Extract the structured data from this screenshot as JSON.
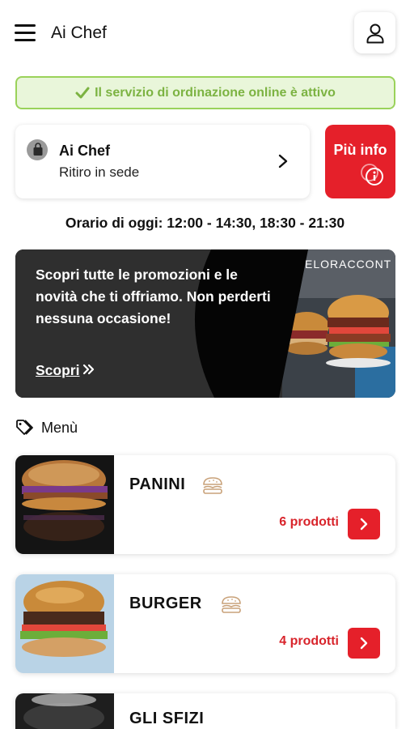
{
  "header": {
    "app_title": "Ai Chef",
    "menu_icon": "hamburger-icon",
    "user_icon": "user-icon"
  },
  "status": {
    "text": "Il servizio di ordinazione online è attivo",
    "icon": "check-icon",
    "color": "#7cb342"
  },
  "store": {
    "name": "Ai Chef",
    "mode": "Ritiro in sede",
    "icon": "shopping-bag-icon"
  },
  "info_button": {
    "label": "Più info",
    "icon": "info-icon",
    "color": "#e5202a"
  },
  "hours": {
    "text": "Orario di oggi: 12:00 - 14:30, 18:30 - 21:30"
  },
  "promo": {
    "text": "Scopri tutte le promozioni e le novità che ti offriamo. Non perderti nessuna occasione!",
    "link_label": "Scopri",
    "image_caption": "ELORACCONT"
  },
  "menu": {
    "heading": "Menù",
    "heading_icon": "tag-icon",
    "categories": [
      {
        "name": "PANINI",
        "count": "6 prodotti",
        "icon": "burger-icon"
      },
      {
        "name": "BURGER",
        "count": "4 prodotti",
        "icon": "burger-icon"
      },
      {
        "name": "GLI SFIZI"
      }
    ]
  }
}
